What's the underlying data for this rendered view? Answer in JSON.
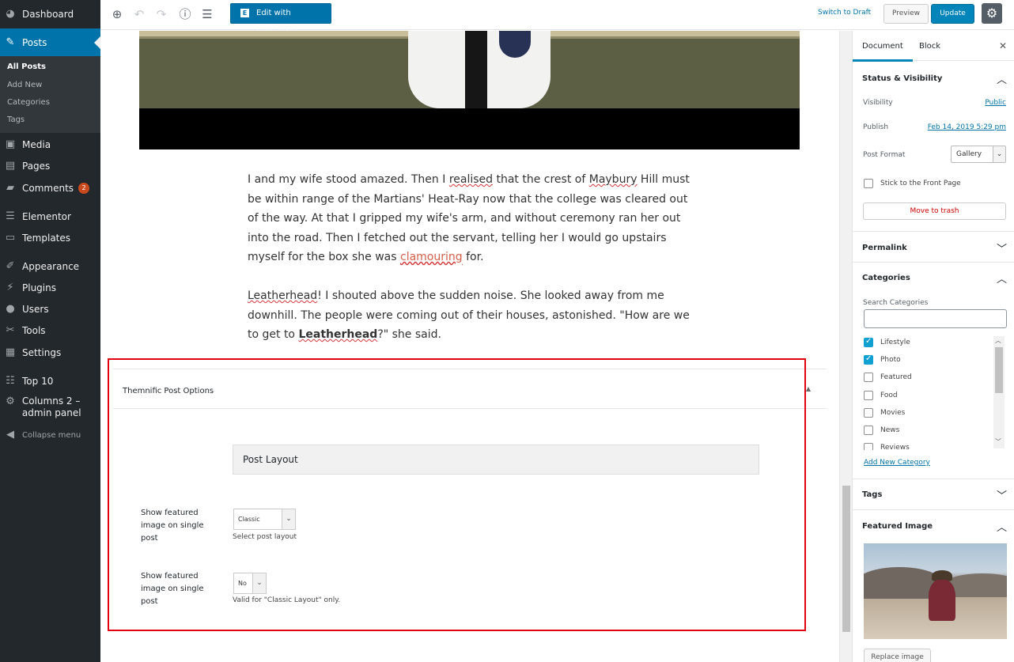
{
  "admin_menu": {
    "items": [
      {
        "label": "Dashboard",
        "icon": "dashboard-icon"
      },
      {
        "label": "Posts",
        "icon": "pin-icon"
      },
      {
        "label": "Media",
        "icon": "media-icon"
      },
      {
        "label": "Pages",
        "icon": "pages-icon"
      },
      {
        "label": "Comments",
        "icon": "comments-icon",
        "badge": "2"
      },
      {
        "label": "Elementor",
        "icon": "elementor-icon"
      },
      {
        "label": "Templates",
        "icon": "folder-icon"
      },
      {
        "label": "Appearance",
        "icon": "brush-icon"
      },
      {
        "label": "Plugins",
        "icon": "plugin-icon"
      },
      {
        "label": "Users",
        "icon": "user-icon"
      },
      {
        "label": "Tools",
        "icon": "wrench-icon"
      },
      {
        "label": "Settings",
        "icon": "settings-icon"
      },
      {
        "label": "Top 10",
        "icon": "list-icon"
      },
      {
        "label": "Columns 2 – admin panel",
        "icon": "gear-icon"
      },
      {
        "label": "Collapse menu",
        "icon": "collapse-icon"
      }
    ],
    "posts_submenu": [
      "All Posts",
      "Add New",
      "Categories",
      "Tags"
    ]
  },
  "toolbar": {
    "elementor_label": "Edit with Elementor",
    "switch_draft": "Switch to Draft",
    "preview": "Preview",
    "update": "Update"
  },
  "content": {
    "p1_a": "I and my wife stood amazed. Then I ",
    "p1_realised": "realised",
    "p1_b": " that the crest of ",
    "p1_maybury": "Maybury",
    "p1_c": " Hill must be within range of the Martians' Heat-Ray now that the college was cleared out of the way. At that I gripped my wife's arm, and without ceremony ran her out into the road. Then I fetched out the servant, telling her I would go upstairs myself for the box she was ",
    "p1_clamouring": "clamouring",
    "p1_d": " for.",
    "p2_leatherhead1": "Leatherhead",
    "p2_a": "! I shouted above the sudden noise. She looked away from me downhill. The people were coming out of their houses, astonished. \"How are we to get to ",
    "p2_leatherhead2": "Leatherhead",
    "p2_b": "?\" she said."
  },
  "meta_box": {
    "title": "Themnific Post Options",
    "section": "Post Layout",
    "option1": {
      "label": "Show featured image on single post",
      "value": "Classic",
      "help": "Select post layout"
    },
    "option2": {
      "label": "Show featured image on single post",
      "value": "No",
      "help": "Valid for \"Classic Layout\" only."
    }
  },
  "inspector": {
    "tabs": [
      "Document",
      "Block"
    ],
    "status_visibility": {
      "title": "Status & Visibility",
      "visibility_label": "Visibility",
      "visibility_value": "Public",
      "publish_label": "Publish",
      "publish_value": "Feb 14, 2019 5:29 pm",
      "format_label": "Post Format",
      "format_value": "Gallery",
      "sticky_label": "Stick to the Front Page",
      "trash_label": "Move to trash"
    },
    "permalink_title": "Permalink",
    "categories": {
      "title": "Categories",
      "search_label": "Search Categories",
      "items": [
        {
          "label": "Lifestyle",
          "checked": true
        },
        {
          "label": "Photo",
          "checked": true
        },
        {
          "label": "Featured",
          "checked": false
        },
        {
          "label": "Food",
          "checked": false
        },
        {
          "label": "Movies",
          "checked": false
        },
        {
          "label": "News",
          "checked": false
        },
        {
          "label": "Reviews",
          "checked": false
        }
      ],
      "add_new": "Add New Category"
    },
    "tags_title": "Tags",
    "featured_image": {
      "title": "Featured Image",
      "replace": "Replace image"
    }
  }
}
